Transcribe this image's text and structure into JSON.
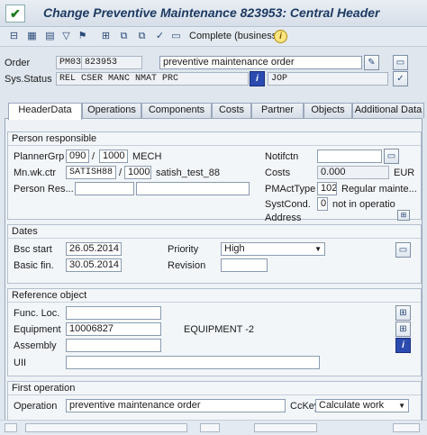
{
  "window": {
    "title": "Change Preventive Maintenance 823953: Central Header",
    "ok_icon": "check-icon"
  },
  "toolbar": {
    "icons": [
      "display-icon",
      "calendar-icon",
      "table-icon",
      "filter-icon",
      "flag-icon",
      "hierarchy-icon",
      "copy-icon",
      "copy-icon",
      "checkmark-icon",
      "document-icon"
    ],
    "complete_label": "Complete (business)",
    "info_icon": "i"
  },
  "header": {
    "order_label": "Order",
    "order_type": "PM03",
    "order_number": "823953",
    "order_description": "preventive maintenance order",
    "sys_status_label": "Sys.Status",
    "sys_status_value": "REL  CSER MANC NMAT PRC",
    "info_button": "i",
    "user_status": "JOP"
  },
  "tabs": [
    "HeaderData",
    "Operations",
    "Components",
    "Costs",
    "Partner",
    "Objects",
    "Additional Data"
  ],
  "person_responsible": {
    "title": "Person responsible",
    "planner_grp_label": "PlannerGrp",
    "planner_grp_value": "090",
    "planner_grp_plant": "1000",
    "planner_grp_text": "MECH",
    "mn_wk_ctr_label": "Mn.wk.ctr",
    "mn_wk_ctr_value": "SATISH88",
    "mn_wk_ctr_plant": "1000",
    "mn_wk_ctr_text": "satish_test_88",
    "person_res_label": "Person Res...",
    "notifctn_label": "Notifctn",
    "costs_label": "Costs",
    "costs_value": "0.000",
    "costs_currency": "EUR",
    "pmacttype_label": "PMActType",
    "pmacttype_value": "102",
    "pmacttype_text": "Regular mainte...",
    "systcond_label": "SystCond.",
    "systcond_value": "0",
    "systcond_text": "not in operatio",
    "address_label": "Address"
  },
  "dates": {
    "title": "Dates",
    "bsc_start_label": "Bsc start",
    "bsc_start_value": "26.05.2014",
    "basic_fin_label": "Basic fin.",
    "basic_fin_value": "30.05.2014",
    "priority_label": "Priority",
    "priority_value": "High",
    "revision_label": "Revision"
  },
  "reference_object": {
    "title": "Reference object",
    "func_loc_label": "Func. Loc.",
    "equipment_label": "Equipment",
    "equipment_value": "10006827",
    "equipment_text": "EQUIPMENT -2",
    "assembly_label": "Assembly",
    "uii_label": "UII"
  },
  "first_operation": {
    "title": "First operation",
    "operation_label": "Operation",
    "operation_value": "preventive maintenance order",
    "cckey_label": "CcKey",
    "cckey_value": "Calculate work"
  }
}
